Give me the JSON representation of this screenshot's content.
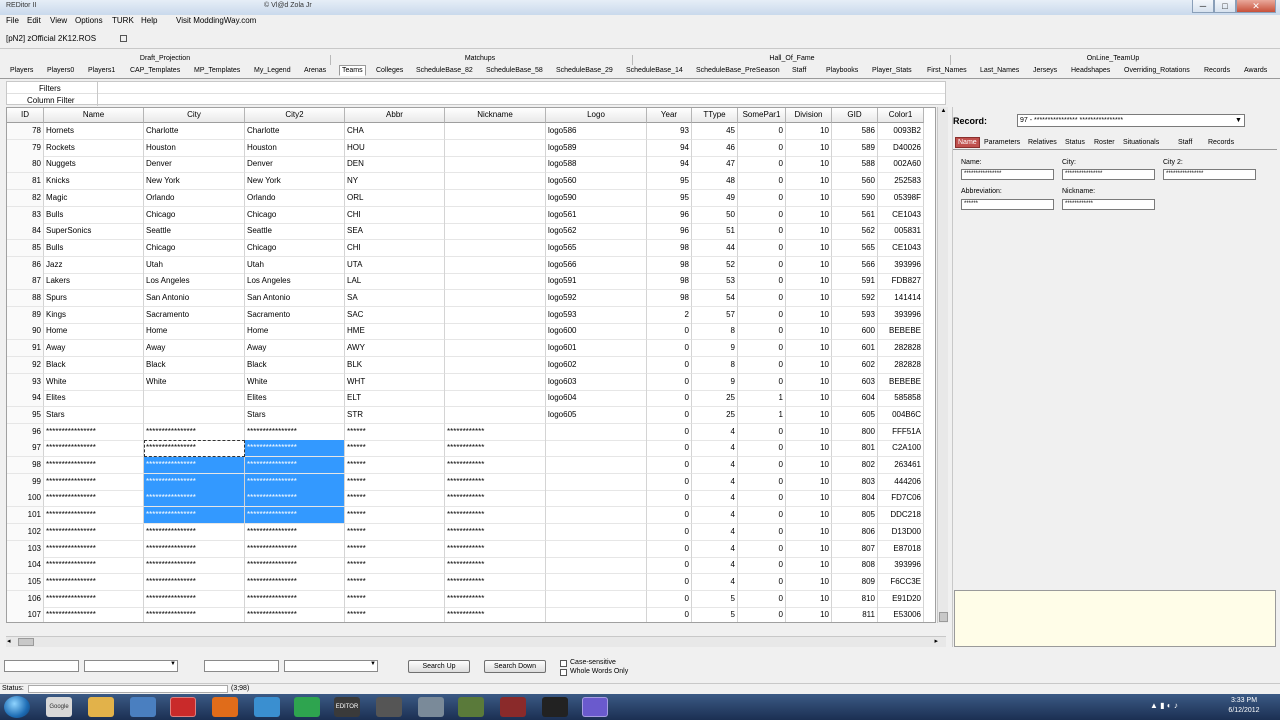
{
  "window": {
    "app_title": "REDitor II",
    "copyright": "© Vl@d Zola Jr",
    "minimize": "─",
    "maximize": "□",
    "close": "✕"
  },
  "menu": [
    "File",
    "Edit",
    "View",
    "Options",
    "TURK",
    "Help",
    "Visit ModdingWay.com"
  ],
  "file_tab": {
    "label": "[pN2] zOfficial 2K12.ROS"
  },
  "group_headers": [
    "Draft_Projection",
    "Matchups",
    "Hall_Of_Fame",
    "OnLine_TeamUp"
  ],
  "tabs": [
    "Players",
    "Players0",
    "Players1",
    "CAP_Templates",
    "MP_Templates",
    "My_Legend",
    "Arenas",
    "Teams",
    "Colleges",
    "ScheduleBase_82",
    "ScheduleBase_58",
    "ScheduleBase_29",
    "ScheduleBase_14",
    "ScheduleBase_PreSeason",
    "Staff",
    "Playbooks",
    "Player_Stats",
    "First_Names",
    "Last_Names",
    "Jerseys",
    "Headshapes",
    "Overriding_Rotations",
    "Records",
    "Awards"
  ],
  "active_tab_index": 7,
  "filters": {
    "label": "Filters",
    "column_filter": "Column Filter"
  },
  "grid": {
    "columns": [
      "ID",
      "Name",
      "City",
      "City2",
      "Abbr",
      "Nickname",
      "Logo",
      "Year",
      "TType",
      "SomePar1",
      "Division",
      "GID",
      "Color1"
    ],
    "selected_row_id": "97",
    "rows": [
      [
        "78",
        "Hornets",
        "Charlotte",
        "Charlotte",
        "CHA",
        "",
        "logo586",
        "93",
        "45",
        "0",
        "10",
        "586",
        "0093B2"
      ],
      [
        "79",
        "Rockets",
        "Houston",
        "Houston",
        "HOU",
        "",
        "logo589",
        "94",
        "46",
        "0",
        "10",
        "589",
        "D40026"
      ],
      [
        "80",
        "Nuggets",
        "Denver",
        "Denver",
        "DEN",
        "",
        "logo588",
        "94",
        "47",
        "0",
        "10",
        "588",
        "002A60"
      ],
      [
        "81",
        "Knicks",
        "New York",
        "New York",
        "NY",
        "",
        "logo560",
        "95",
        "48",
        "0",
        "10",
        "560",
        "252583"
      ],
      [
        "82",
        "Magic",
        "Orlando",
        "Orlando",
        "ORL",
        "",
        "logo590",
        "95",
        "49",
        "0",
        "10",
        "590",
        "05398F"
      ],
      [
        "83",
        "Bulls",
        "Chicago",
        "Chicago",
        "CHI",
        "",
        "logo561",
        "96",
        "50",
        "0",
        "10",
        "561",
        "CE1043"
      ],
      [
        "84",
        "SuperSonics",
        "Seattle",
        "Seattle",
        "SEA",
        "",
        "logo562",
        "96",
        "51",
        "0",
        "10",
        "562",
        "005831"
      ],
      [
        "85",
        "Bulls",
        "Chicago",
        "Chicago",
        "CHI",
        "",
        "logo565",
        "98",
        "44",
        "0",
        "10",
        "565",
        "CE1043"
      ],
      [
        "86",
        "Jazz",
        "Utah",
        "Utah",
        "UTA",
        "",
        "logo566",
        "98",
        "52",
        "0",
        "10",
        "566",
        "393996"
      ],
      [
        "87",
        "Lakers",
        "Los Angeles",
        "Los Angeles",
        "LAL",
        "",
        "logo591",
        "98",
        "53",
        "0",
        "10",
        "591",
        "FDB827"
      ],
      [
        "88",
        "Spurs",
        "San Antonio",
        "San Antonio",
        "SA",
        "",
        "logo592",
        "98",
        "54",
        "0",
        "10",
        "592",
        "141414"
      ],
      [
        "89",
        "Kings",
        "Sacramento",
        "Sacramento",
        "SAC",
        "",
        "logo593",
        "2",
        "57",
        "0",
        "10",
        "593",
        "393996"
      ],
      [
        "90",
        "Home",
        "Home",
        "Home",
        "HME",
        "",
        "logo600",
        "0",
        "8",
        "0",
        "10",
        "600",
        "BEBEBE"
      ],
      [
        "91",
        "Away",
        "Away",
        "Away",
        "AWY",
        "",
        "logo601",
        "0",
        "9",
        "0",
        "10",
        "601",
        "282828"
      ],
      [
        "92",
        "Black",
        "Black",
        "Black",
        "BLK",
        "",
        "logo602",
        "0",
        "8",
        "0",
        "10",
        "602",
        "282828"
      ],
      [
        "93",
        "White",
        "White",
        "White",
        "WHT",
        "",
        "logo603",
        "0",
        "9",
        "0",
        "10",
        "603",
        "BEBEBE"
      ],
      [
        "94",
        "Elites",
        "",
        "Elites",
        "ELT",
        "",
        "logo604",
        "0",
        "25",
        "1",
        "10",
        "604",
        "585858"
      ],
      [
        "95",
        "Stars",
        "",
        "Stars",
        "STR",
        "",
        "logo605",
        "0",
        "25",
        "1",
        "10",
        "605",
        "004B6C"
      ],
      [
        "96",
        "****************",
        "****************",
        "****************",
        "******",
        "************",
        "",
        "0",
        "4",
        "0",
        "10",
        "800",
        "FFF51A"
      ],
      [
        "97",
        "****************",
        "****************",
        "****************",
        "******",
        "************",
        "",
        "0",
        "4",
        "0",
        "10",
        "801",
        "C2A100"
      ],
      [
        "98",
        "****************",
        "****************",
        "****************",
        "******",
        "************",
        "",
        "0",
        "4",
        "0",
        "10",
        "802",
        "263461"
      ],
      [
        "99",
        "****************",
        "****************",
        "****************",
        "******",
        "************",
        "",
        "0",
        "4",
        "0",
        "10",
        "803",
        "444206"
      ],
      [
        "100",
        "****************",
        "****************",
        "****************",
        "******",
        "************",
        "",
        "0",
        "4",
        "0",
        "10",
        "804",
        "FD7C06"
      ],
      [
        "101",
        "****************",
        "****************",
        "****************",
        "******",
        "************",
        "",
        "0",
        "4",
        "0",
        "10",
        "805",
        "DDC218"
      ],
      [
        "102",
        "****************",
        "****************",
        "****************",
        "******",
        "************",
        "",
        "0",
        "4",
        "0",
        "10",
        "806",
        "D13D00"
      ],
      [
        "103",
        "****************",
        "****************",
        "****************",
        "******",
        "************",
        "",
        "0",
        "4",
        "0",
        "10",
        "807",
        "E87018"
      ],
      [
        "104",
        "****************",
        "****************",
        "****************",
        "******",
        "************",
        "",
        "0",
        "4",
        "0",
        "10",
        "808",
        "393996"
      ],
      [
        "105",
        "****************",
        "****************",
        "****************",
        "******",
        "************",
        "",
        "0",
        "4",
        "0",
        "10",
        "809",
        "F6CC3E"
      ],
      [
        "106",
        "****************",
        "****************",
        "****************",
        "******",
        "************",
        "",
        "0",
        "5",
        "0",
        "10",
        "810",
        "E91D20"
      ],
      [
        "107",
        "****************",
        "****************",
        "****************",
        "******",
        "************",
        "",
        "0",
        "5",
        "0",
        "10",
        "811",
        "E53006"
      ]
    ]
  },
  "record_panel": {
    "label": "Record:",
    "value": "97 - **************** ****************",
    "subtabs": [
      "Name",
      "Parameters",
      "Relatives",
      "Status",
      "Roster",
      "Situationals",
      "Staff",
      "Records"
    ],
    "active_subtab": "Name",
    "fields": {
      "name_label": "Name:",
      "name_value": "****************",
      "city_label": "City:",
      "city_value": "****************",
      "city2_label": "City 2:",
      "city2_value": "****************",
      "abbr_label": "Abbreviation:",
      "abbr_value": "******",
      "nick_label": "Nickname:",
      "nick_value": "************"
    }
  },
  "search": {
    "search_up": "Search Up",
    "search_down": "Search Down",
    "case_sensitive": "Case-sensitive",
    "whole_words": "Whole Words Only"
  },
  "status": {
    "label": "Status:",
    "coords": "(3;98)"
  },
  "taskbar": {
    "icons": [
      "Google Chrome",
      "",
      "",
      "",
      "",
      "",
      "",
      "EDITOR",
      "",
      "",
      "",
      "",
      "",
      ""
    ],
    "time": "3:33 PM",
    "date": "6/12/2012"
  },
  "colors": {
    "selection": "#3399ff",
    "active_subtab": "#c0504d",
    "notes_bg": "#fffde8"
  }
}
